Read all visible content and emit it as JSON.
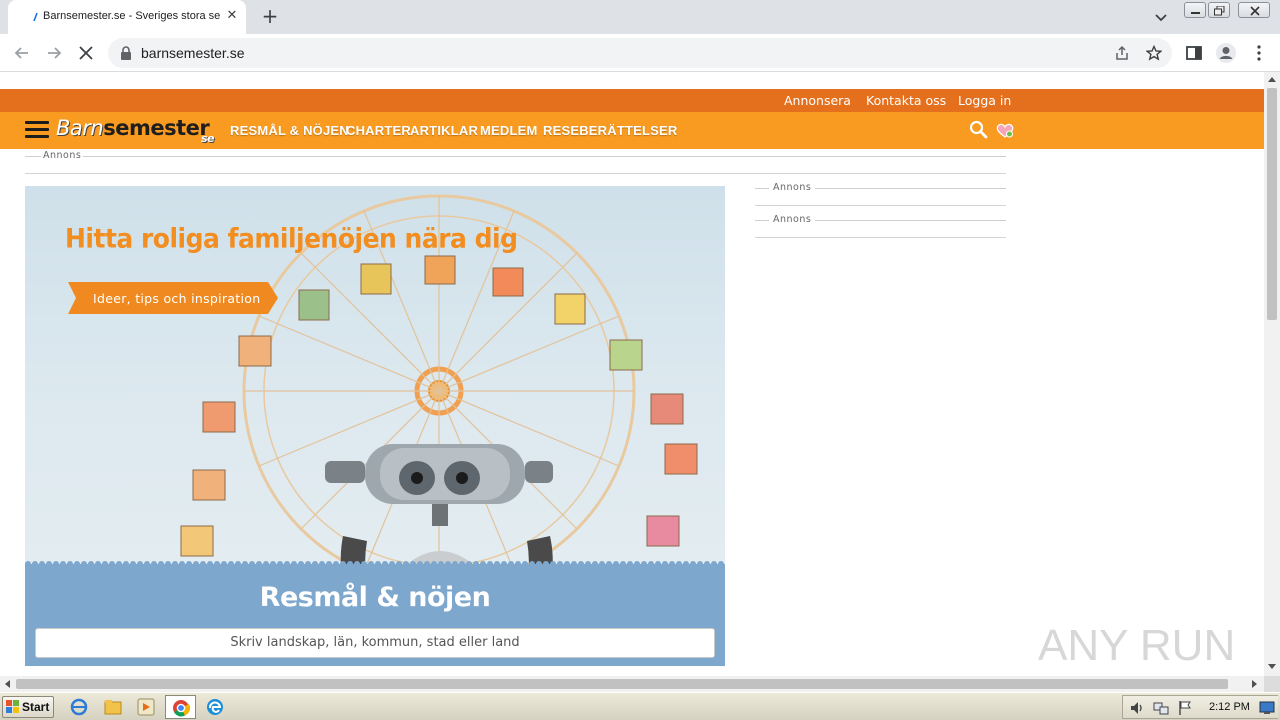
{
  "browser": {
    "tab_title": "Barnsemester.se - Sveriges stora se",
    "url": "barnsemester.se"
  },
  "site": {
    "top_links": [
      "Annonsera",
      "Kontakta oss",
      "Logga in"
    ],
    "logo_part1": "Barn",
    "logo_part2": "semester",
    "logo_part3": "se",
    "nav": [
      "RESMÅL & NÖJEN",
      "CHARTER",
      "ARTIKLAR",
      "MEDLEM",
      "RESEBERÄTTELSER"
    ],
    "ad_label": "Annons",
    "hero_title": "Hitta roliga familjenöjen nära dig",
    "hero_cta": "Ideer, tips och inspiration",
    "panel_title": "Resmål & nöjen",
    "search_placeholder": "Skriv landskap, län, kommun, stad eller land"
  },
  "watermark": "ANY RUN",
  "taskbar": {
    "start": "Start",
    "clock": "2:12 PM"
  },
  "colors": {
    "topbar": "#e4701e",
    "nav": "#f99b20",
    "hero_title": "#f28d20",
    "panel": "#7ea7cd"
  }
}
